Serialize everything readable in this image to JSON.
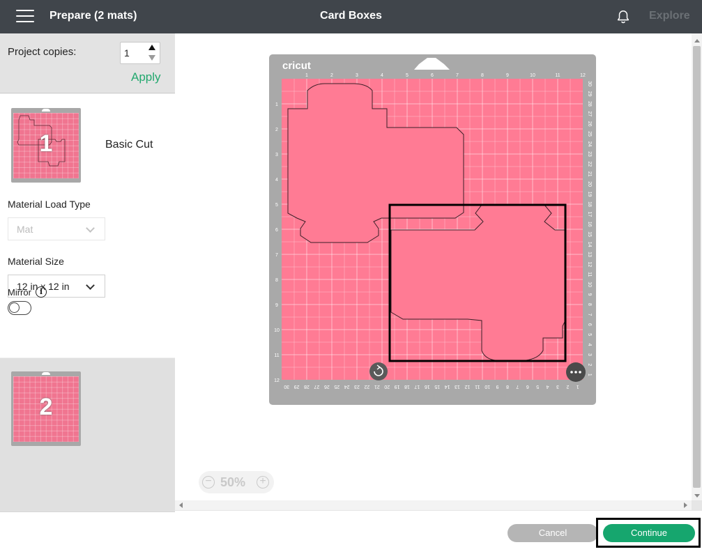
{
  "header": {
    "title": "Prepare (2 mats)",
    "project_name": "Card Boxes",
    "explore_label": "Explore"
  },
  "left_panel": {
    "copies_label": "Project copies:",
    "copies_value": "1",
    "apply_label": "Apply",
    "mats": [
      {
        "number": "1",
        "mode": "Basic Cut"
      },
      {
        "number": "2"
      }
    ],
    "material_load_type_label": "Material Load Type",
    "material_load_type_value": "Mat",
    "material_size_label": "Material Size",
    "material_size_value": "12 in x 12 in",
    "mirror_label": "Mirror",
    "mirror_on": false
  },
  "mat_preview": {
    "brand": "cricut",
    "top_ruler": [
      "1",
      "2",
      "3",
      "4",
      "5",
      "6",
      "7",
      "8",
      "9",
      "10",
      "11",
      "12"
    ],
    "left_ruler": [
      "1",
      "2",
      "3",
      "4",
      "5",
      "6",
      "7",
      "8",
      "9",
      "10",
      "11",
      "12"
    ],
    "right_ruler": [
      "30",
      "29",
      "28",
      "27",
      "26",
      "25",
      "24",
      "23",
      "22",
      "21",
      "20",
      "19",
      "18",
      "17",
      "16",
      "15",
      "14",
      "13",
      "12",
      "11",
      "10",
      "9",
      "8",
      "7",
      "6",
      "5",
      "4",
      "3",
      "2",
      "1"
    ],
    "bottom_ruler": [
      "30",
      "29",
      "28",
      "27",
      "26",
      "25",
      "24",
      "23",
      "22",
      "21",
      "20",
      "19",
      "18",
      "17",
      "16",
      "15",
      "14",
      "13",
      "12",
      "11",
      "10",
      "9",
      "8",
      "7",
      "6",
      "5",
      "4",
      "3",
      "2",
      "1"
    ],
    "colors": {
      "mat": "#a9a9a9",
      "material": "#ff7b94"
    }
  },
  "zoom": {
    "level": "50%"
  },
  "footer": {
    "cancel_label": "Cancel",
    "continue_label": "Continue"
  }
}
